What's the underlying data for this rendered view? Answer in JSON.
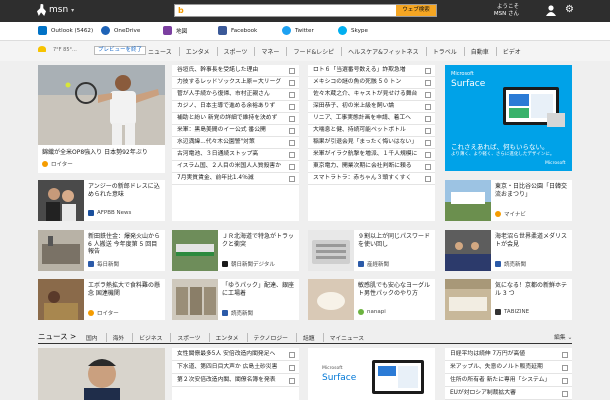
{
  "header": {
    "brand": "msn",
    "search_placeholder": "",
    "search_button": "ウェブ検索",
    "user_line1": "ようこそ",
    "user_line2": "MSN さん"
  },
  "applinks": [
    {
      "label": "Outlook (5462)",
      "icon": "outlook-icon",
      "color": "#0072c6"
    },
    {
      "label": "OneDrive",
      "icon": "onedrive-icon",
      "color": "#1e63b7"
    },
    {
      "label": "地図",
      "icon": "maps-icon",
      "color": "#7b3fa0"
    },
    {
      "label": "Facebook",
      "icon": "facebook-icon",
      "color": "#3b5998"
    },
    {
      "label": "Twitter",
      "icon": "twitter-icon",
      "color": "#1da1f2"
    },
    {
      "label": "Skype",
      "icon": "skype-icon",
      "color": "#00aff0"
    }
  ],
  "nav": {
    "temp": "7°F 85°...",
    "preview": "プレビューを終了",
    "categories": [
      "ニュース",
      "エンタメ",
      "スポーツ",
      "マネー",
      "フード&レシピ",
      "ヘルスケア&フィットネス",
      "トラベル",
      "自動車",
      "ビデオ"
    ]
  },
  "hero": {
    "title": "錦織が全米OP8強入り 日本勢92年ぶり",
    "source": "ロイター"
  },
  "headlines_col1": [
    "谷垣氏、幹事長を受諾した理由",
    "力技するレッドソックス上原＝大リーグ",
    "菅が人手続から復帰、市村正親さん",
    "カジノ、日本主導で進める余裕ありず",
    "補助と紛い 新党の詳細で維持を決めず",
    "米軍：黒島美間のイー公式 番公開",
    "水辺満緯...代々木公園警\"対策",
    "古河電池、３日通続ストップ高",
    "イスラム国、２人目の米国人人質殺害か",
    "7月実質賃金、前年比1.4％減"
  ],
  "headlines_col2": [
    "ロト６「当選番号数える」詐欺急増",
    "メキシコの謎の魚の死骸 5 0 トン",
    "佐々木蔵之介、キャストが見せける舞台",
    "深田恭子、初の米上級を飼い論",
    "リニア、工事実態計画を申請、着工へ",
    "大喘息と健、持続可能ペットボトル",
    "稲果が引退会見「まったく悔いはない」",
    "米軍がイラク航撃を増派、１千人規模に",
    "東京電力、開業次期に会社判断に頼る",
    "スマトラトラ：赤ちゃん３頭すくすく"
  ],
  "ad": {
    "brand": "Microsoft",
    "product": "Surface",
    "line1": "これさえあれば、何もいらない。",
    "line2": "より薄く、より軽く、さらに進化したデザインに。",
    "footer": "Microsoft"
  },
  "row2": [
    {
      "title": "アンジーの新郎ドレスに込められた意味",
      "source": "AFPBB News"
    },
    {
      "title": "東京・日比谷公園「日韓交流おまつり」",
      "source": "マイナビ"
    }
  ],
  "row3": [
    {
      "title": "新田鉄住金：爆発火山から 6 人搬送 今年度第 5 回目報告",
      "source": "毎日新聞"
    },
    {
      "title": "ＪＲ北海道で特急がトラックと衝突",
      "source": "朝日新聞デジタル"
    },
    {
      "title": "９割以上が同じパスワードを使い回し",
      "source": "産経新聞"
    },
    {
      "title": "海老沼ら世界柔道メダリストが会見",
      "source": "読売新聞"
    }
  ],
  "row4": [
    {
      "title": "エボラ熱拡大で食料難の懸念 国連機関",
      "source": "ロイター"
    },
    {
      "title": "「ゆうパック」配達、銀座に工場着",
      "source": "読売新聞"
    },
    {
      "title": "敏感肌でも安心なヨーグルト男性パックのやり方",
      "source": "nanapi"
    },
    {
      "title": "気になる！京都の新鮮ホテル 3 つ",
      "source": "TABIZINE"
    }
  ],
  "news_section": {
    "heading": "ニュース >",
    "items": [
      "国内",
      "海外",
      "ビジネス",
      "スポーツ",
      "エンタメ",
      "テクノロジー",
      "話題",
      "マイニュース"
    ],
    "edit": "編集"
  },
  "news_col1": [
    "女性閣僚最多5人 安倍改造内閣発足へ",
    "下水道、第四日目大声か 広島土砂災害",
    "第２次安倍改造内閣、閣僚名簿を発表"
  ],
  "news_col2": [
    "日経平均は続伸 7万円が高値",
    "米アップル、失意のノルト販売延期",
    "住所の所有者 新たに専用「システム」",
    "EUが対ロシア制裁拡大審"
  ],
  "ad2": {
    "brand": "Microsoft",
    "product": "Surface"
  },
  "colors": {
    "topbar": "#2e2e2e",
    "search_button": "#f5a623",
    "ad_bg": "#00a2e8",
    "accent": "#1a6ac8"
  }
}
